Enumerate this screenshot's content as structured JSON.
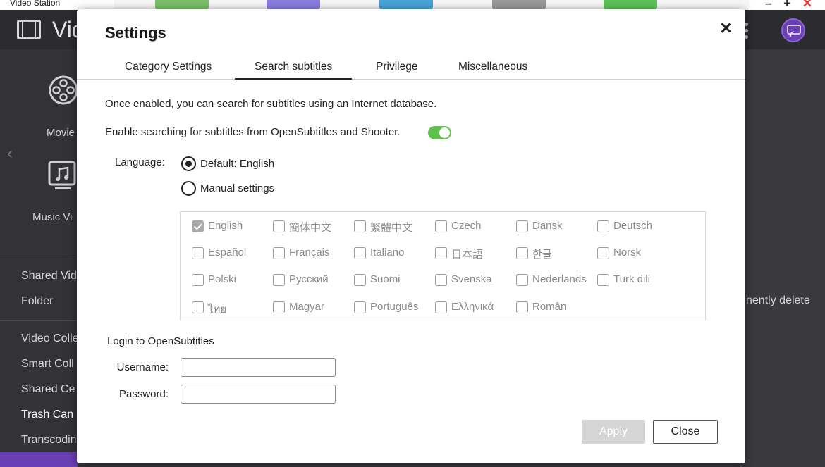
{
  "app": {
    "window_title": "Video Station",
    "logo_text": "Vid",
    "window_controls": [
      "–",
      "+",
      "✕"
    ]
  },
  "sidebar": {
    "movies_label": "Movie",
    "music_label": "Music Vi",
    "items": [
      {
        "label": "Shared Vid"
      },
      {
        "label": "Folder"
      },
      {
        "label": "Video Colle"
      },
      {
        "label": "Smart Coll"
      },
      {
        "label": "Shared Ce"
      },
      {
        "label": "Trash Can"
      },
      {
        "label": "Transcodin"
      }
    ]
  },
  "background": {
    "right_text": "nently delete"
  },
  "dialog": {
    "title": "Settings",
    "tabs": [
      {
        "label": "Category Settings"
      },
      {
        "label": "Search subtitles",
        "active": true
      },
      {
        "label": "Privilege"
      },
      {
        "label": "Miscellaneous"
      }
    ],
    "description": "Once enabled, you can search for subtitles using an Internet database.",
    "enable_label": "Enable searching for subtitles from OpenSubtitles and Shooter.",
    "enable_on": true,
    "language_label": "Language:",
    "radio_default": "Default: English",
    "radio_manual": "Manual settings",
    "languages": [
      {
        "label": "English",
        "checked": true
      },
      {
        "label": "簡体中文",
        "checked": false
      },
      {
        "label": "繁體中文",
        "checked": false
      },
      {
        "label": "Czech",
        "checked": false
      },
      {
        "label": "Dansk",
        "checked": false
      },
      {
        "label": "Deutsch",
        "checked": false
      },
      {
        "label": "Español",
        "checked": false
      },
      {
        "label": "Français",
        "checked": false
      },
      {
        "label": "Italiano",
        "checked": false
      },
      {
        "label": "日本語",
        "checked": false
      },
      {
        "label": "한글",
        "checked": false
      },
      {
        "label": "Norsk",
        "checked": false
      },
      {
        "label": "Polski",
        "checked": false
      },
      {
        "label": "Русский",
        "checked": false
      },
      {
        "label": "Suomi",
        "checked": false
      },
      {
        "label": "Svenska",
        "checked": false
      },
      {
        "label": "Nederlands",
        "checked": false
      },
      {
        "label": "Turk dili",
        "checked": false
      },
      {
        "label": "ไทย",
        "checked": false
      },
      {
        "label": "Magyar",
        "checked": false
      },
      {
        "label": "Português",
        "checked": false
      },
      {
        "label": "Ελληνικά",
        "checked": false
      },
      {
        "label": "Român",
        "checked": false
      }
    ],
    "login_title": "Login to OpenSubtitles",
    "username_label": "Username:",
    "username_value": "",
    "password_label": "Password:",
    "password_value": "",
    "apply_label": "Apply",
    "close_label": "Close"
  },
  "colors": {
    "accent_purple": "#6a3fb5",
    "toggle_green": "#5ec24c"
  }
}
